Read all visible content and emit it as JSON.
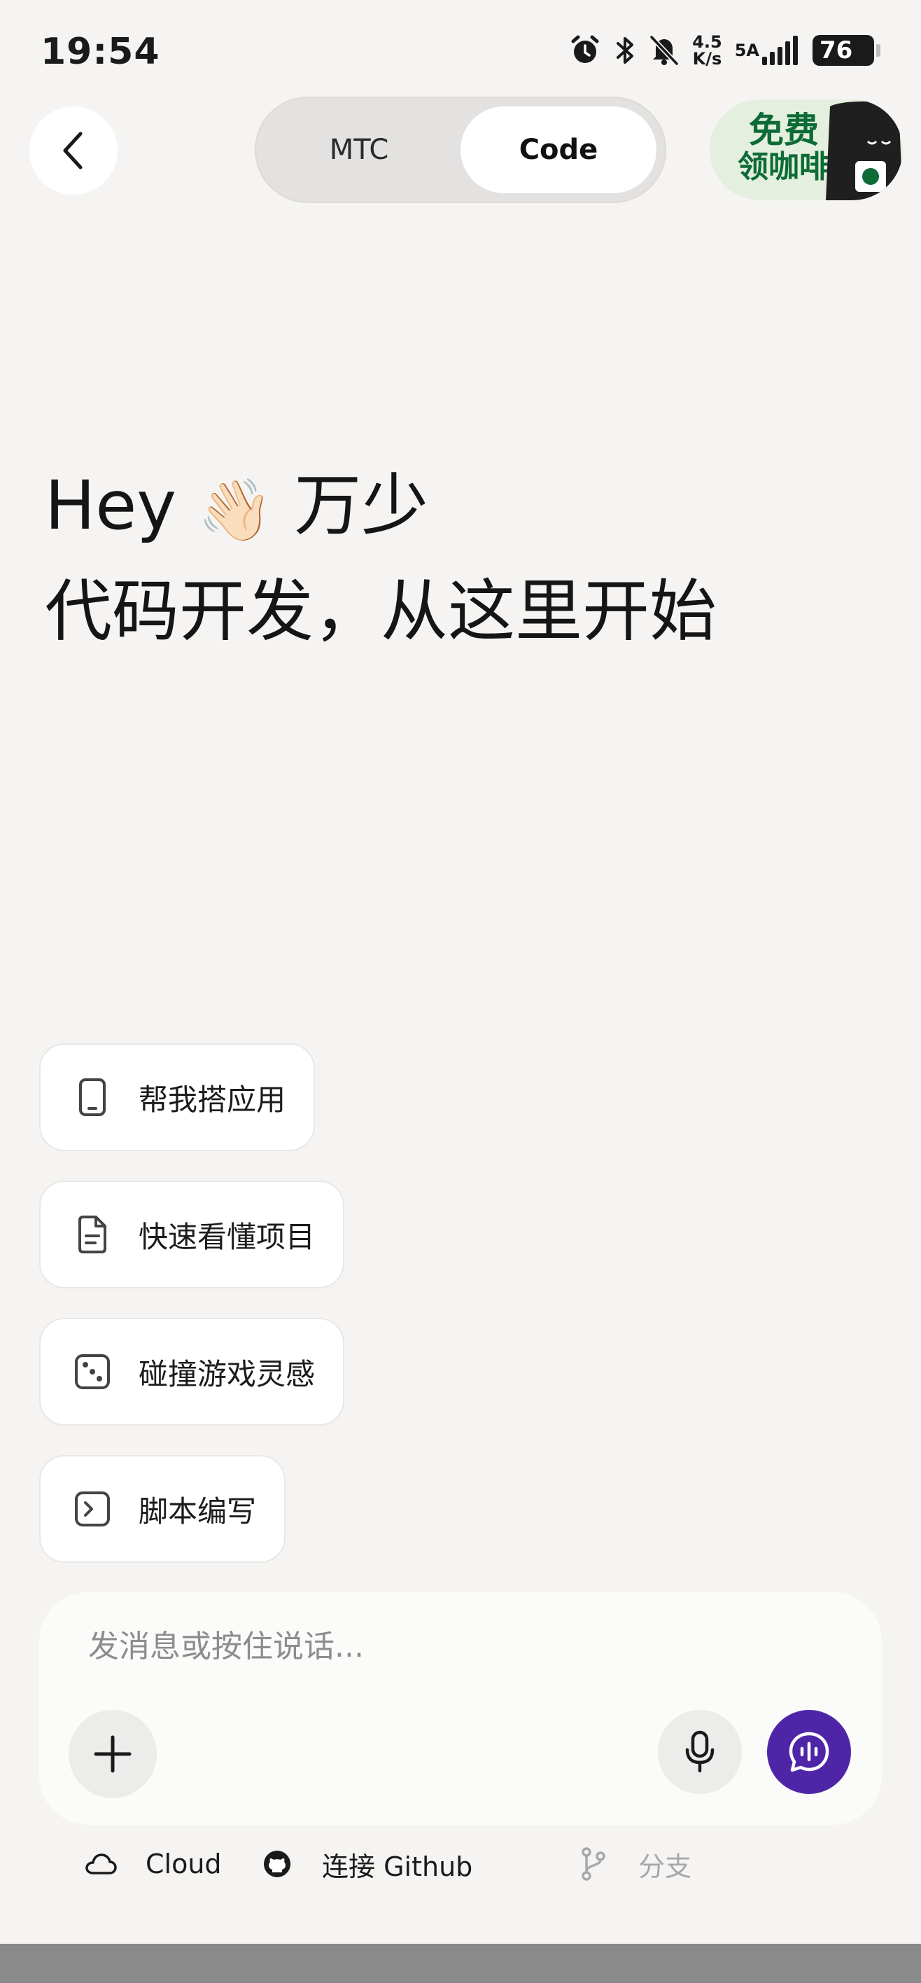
{
  "status_bar": {
    "time": "19:54",
    "net_speed_value": "4.5",
    "net_speed_unit": "K/s",
    "signal_label": "5A",
    "battery": "76",
    "icons": [
      "alarm-icon",
      "bluetooth-icon",
      "mute-icon",
      "signal-icon",
      "battery-icon"
    ]
  },
  "header": {
    "tabs": [
      {
        "label": "MTC",
        "active": false
      },
      {
        "label": "Code",
        "active": true
      }
    ],
    "promo_line1": "免费",
    "promo_line2": "领咖啡"
  },
  "greeting": {
    "line1_prefix": "Hey",
    "wave_emoji": "👋🏻",
    "name": "万少",
    "line2": "代码开发，从这里开始"
  },
  "suggestions": [
    {
      "label": "帮我搭应用",
      "icon": "phone-icon"
    },
    {
      "label": "快速看懂项目",
      "icon": "document-icon"
    },
    {
      "label": "碰撞游戏灵感",
      "icon": "dice-icon"
    },
    {
      "label": "脚本编写",
      "icon": "terminal-icon"
    }
  ],
  "composer": {
    "placeholder": "发消息或按住说话...",
    "value": ""
  },
  "bottom_bar": {
    "cloud_label": "Cloud",
    "github_label": "连接 Github",
    "branch_label": "分支"
  },
  "colors": {
    "background": "#f5f4f2",
    "accent": "#4f25a8",
    "promo_green": "#0d6b35"
  }
}
